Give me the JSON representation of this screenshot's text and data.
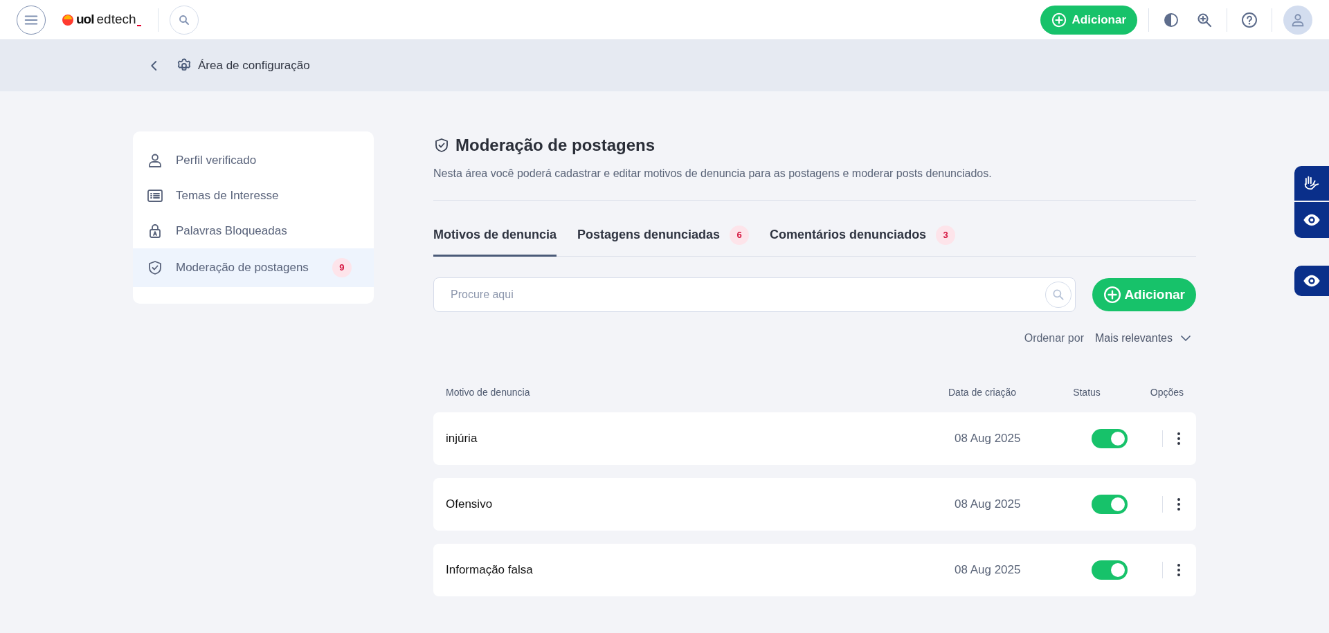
{
  "header": {
    "logo": {
      "strong": "uol",
      "light": "edtech"
    },
    "add_button": "Adicionar"
  },
  "breadcrumb": {
    "title": "Área de configuração"
  },
  "sidebar": {
    "items": [
      {
        "label": "Perfil verificado",
        "kind": "person",
        "selected": false
      },
      {
        "label": "Temas de Interesse",
        "kind": "list",
        "selected": false
      },
      {
        "label": "Palavras Bloqueadas",
        "kind": "lock",
        "selected": false
      },
      {
        "label": "Moderação de postagens",
        "kind": "shield",
        "selected": true,
        "count": "9"
      }
    ]
  },
  "page": {
    "title": "Moderação de postagens",
    "description": "Nesta área você poderá cadastrar e editar motivos de denuncia para as postagens e moderar posts denunciados."
  },
  "tabs": [
    {
      "label": "Motivos de denuncia",
      "selected": true
    },
    {
      "label": "Postagens denunciadas",
      "selected": false,
      "count": "6"
    },
    {
      "label": "Comentários denunciados",
      "selected": false,
      "count": "3"
    }
  ],
  "search": {
    "placeholder": "Procure aqui"
  },
  "add_button": "Adicionar",
  "sort": {
    "label": "Ordenar por",
    "value": "Mais relevantes"
  },
  "table": {
    "columns": [
      "Motivo de denuncia",
      "Data de criação",
      "Status",
      "Opções"
    ],
    "rows": [
      {
        "reason": "injúria",
        "date": "08 Aug 2025",
        "on": true
      },
      {
        "reason": "Ofensivo",
        "date": "08 Aug 2025",
        "on": true
      },
      {
        "reason": "Informação falsa",
        "date": "08 Aug 2025",
        "on": true
      }
    ]
  }
}
